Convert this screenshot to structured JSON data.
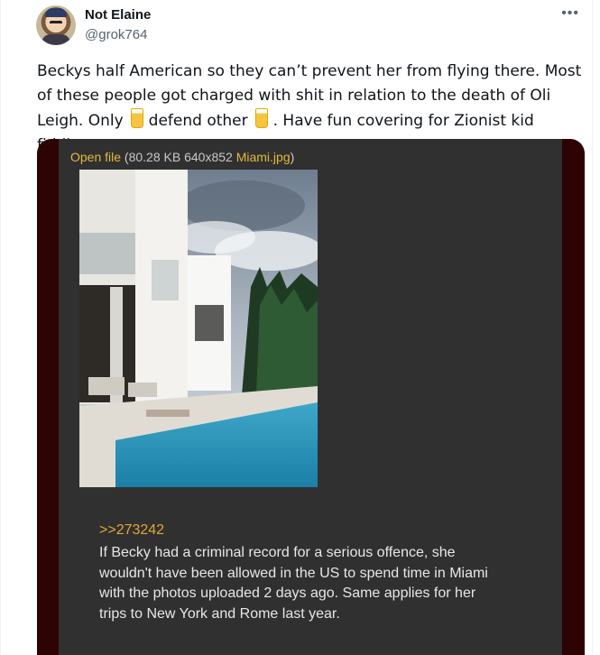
{
  "tweet": {
    "display_name": "Not Elaine",
    "handle": "@grok764",
    "more_icon": "more-horizontal-icon",
    "text": {
      "part1": "Beckys half American so they can’t prevent her from flying there. Most of these people got charged with shit in relation to the death of Oli Leigh. Only",
      "part2": "defend other",
      "part3": ". Have fun covering for Zionist kid fiddlers",
      "emoji": "juice-cup-emoji"
    }
  },
  "attachment": {
    "open_file_label": "Open file",
    "file_meta": " (80.28 KB 640x852 ",
    "file_name": "Miami.jpg",
    "file_meta_end": ")",
    "reply_ref": ">>273242",
    "reply_text": "If Becky had a criminal record for a serious offence, she wouldn't have been allowed in the US to spend time in Miami with the photos uploaded 2 days ago. Same applies for her trips to New York and Rome last year."
  },
  "colors": {
    "link_gold": "#e2b93f",
    "panel_bg": "#303030",
    "card_border": "#2d0303",
    "handle_grey": "#536471"
  }
}
